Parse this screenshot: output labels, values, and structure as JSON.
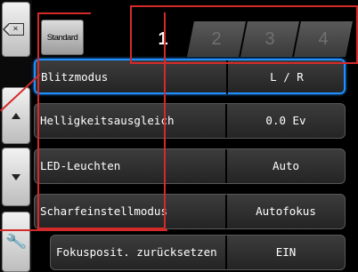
{
  "side": {
    "back_icon": "back-x-icon",
    "up_icon": "arrow-up-icon",
    "down_icon": "arrow-down-icon",
    "tool_icon": "wrench-icon"
  },
  "header": {
    "mode": "Standard",
    "tabs": [
      "1",
      "2",
      "3",
      "4"
    ],
    "active_tab": "1"
  },
  "menu": [
    {
      "label": "Blitzmodus",
      "value": "L / R"
    },
    {
      "label": "Helligkeitsausgleich",
      "value": "0.0 Ev"
    },
    {
      "label": "LED-Leuchten",
      "value": "Auto"
    },
    {
      "label": "Scharfeinstellmodus",
      "value": "Autofokus"
    },
    {
      "label": "Fokusposit. zurücksetzen",
      "value": "EIN"
    }
  ],
  "colors": {
    "selection": "#1e90ff",
    "annotation": "#d42a2a"
  }
}
